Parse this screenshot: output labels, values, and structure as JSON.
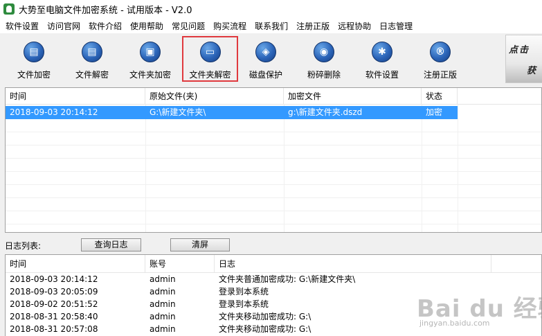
{
  "window": {
    "title": "大势至电脑文件加密系统 - 试用版本 - V2.0"
  },
  "menu": [
    "软件设置",
    "访问官网",
    "软件介绍",
    "使用帮助",
    "常见问题",
    "购买流程",
    "联系我们",
    "注册正版",
    "远程协助",
    "日志管理"
  ],
  "toolbar": {
    "buttons": [
      {
        "label": "文件加密",
        "icon": "file-lock-icon",
        "glyph": "▤"
      },
      {
        "label": "文件解密",
        "icon": "file-unlock-icon",
        "glyph": "▤"
      },
      {
        "label": "文件夹加密",
        "icon": "folder-lock-icon",
        "glyph": "▣"
      },
      {
        "label": "文件夹解密",
        "icon": "folder-unlock-icon",
        "glyph": "▭"
      },
      {
        "label": "磁盘保护",
        "icon": "disk-shield-icon",
        "glyph": "◈"
      },
      {
        "label": "粉碎删除",
        "icon": "shred-icon",
        "glyph": "◉"
      },
      {
        "label": "软件设置",
        "icon": "gear-icon",
        "glyph": "✱"
      },
      {
        "label": "注册正版",
        "icon": "registered-icon",
        "glyph": "®"
      }
    ],
    "selected_index": 3
  },
  "banner": {
    "line1": "点击",
    "line2": "获"
  },
  "file_table": {
    "columns": [
      "时间",
      "原始文件(夹)",
      "加密文件",
      "状态"
    ],
    "rows": [
      {
        "time": "2018-09-03 20:14:12",
        "source": "G:\\新建文件夹\\",
        "encrypted": "g:\\新建文件夹.dszd",
        "status": "加密"
      }
    ]
  },
  "log_bar": {
    "label": "日志列表:",
    "query_button": "查询日志",
    "clear_button": "清屏"
  },
  "log_table": {
    "columns": [
      "时间",
      "账号",
      "日志"
    ],
    "rows": [
      {
        "time": "2018-09-03 20:14:12",
        "account": "admin",
        "log": "文件夹普通加密成功: G:\\新建文件夹\\"
      },
      {
        "time": "2018-09-03 20:05:09",
        "account": "admin",
        "log": "登录到本系统"
      },
      {
        "time": "2018-09-02 20:51:52",
        "account": "admin",
        "log": "登录到本系统"
      },
      {
        "time": "2018-08-31 20:58:40",
        "account": "admin",
        "log": "文件夹移动加密成功: G:\\"
      },
      {
        "time": "2018-08-31 20:57:08",
        "account": "admin",
        "log": "文件夹移动加密成功: G:\\"
      }
    ]
  },
  "watermark": {
    "text": "Bai du 经验",
    "sub": "jingyan.baidu.com"
  },
  "colors": {
    "selection": "#3399ff",
    "highlight_border": "#e0393e",
    "icon_blue": "#2b64b8"
  }
}
